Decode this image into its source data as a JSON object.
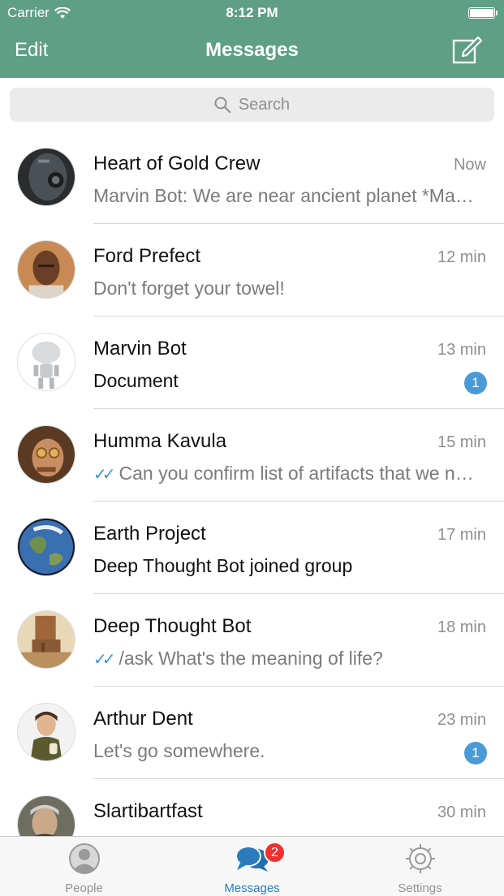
{
  "status_bar": {
    "carrier": "Carrier",
    "time": "8:12 PM"
  },
  "nav": {
    "edit_label": "Edit",
    "title": "Messages",
    "compose_icon": "compose-icon"
  },
  "search": {
    "placeholder": "Search"
  },
  "chats": [
    {
      "name": "Heart of Gold Crew",
      "time": "Now",
      "preview": "Marvin Bot: We are near ancient planet *Magrathea*",
      "read_check": false,
      "badge": null
    },
    {
      "name": "Ford Prefect",
      "time": "12 min",
      "preview": "Don't forget your towel!",
      "read_check": false,
      "badge": null
    },
    {
      "name": "Marvin Bot",
      "time": "13 min",
      "preview": "Document",
      "read_check": false,
      "badge": "1"
    },
    {
      "name": "Humma Kavula",
      "time": "15 min",
      "preview": "Can you confirm list of artifacts that we need to find?",
      "read_check": true,
      "badge": null
    },
    {
      "name": "Earth Project",
      "time": "17 min",
      "preview": "Deep Thought Bot joined group",
      "read_check": false,
      "badge": null
    },
    {
      "name": "Deep Thought Bot",
      "time": "18 min",
      "preview": "/ask What's the meaning of life?",
      "read_check": true,
      "badge": null
    },
    {
      "name": "Arthur Dent",
      "time": "23 min",
      "preview": "Let's go somewhere.",
      "read_check": false,
      "badge": "1"
    },
    {
      "name": "Slartibartfast",
      "time": "30 min",
      "preview": "",
      "read_check": false,
      "badge": null
    }
  ],
  "tabs": [
    {
      "label": "People",
      "icon": "person-icon"
    },
    {
      "label": "Messages",
      "icon": "chat-bubbles-icon",
      "badge": "2"
    },
    {
      "label": "Settings",
      "icon": "gear-icon"
    }
  ],
  "colors": {
    "header": "#5e9f86",
    "accent": "#2b7bbd",
    "badge_unread": "#4a9ad8",
    "badge_tab": "#f0302f"
  }
}
